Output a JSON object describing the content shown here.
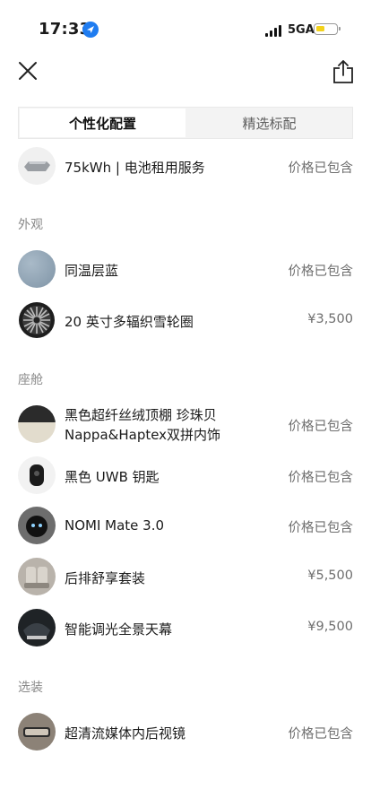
{
  "status_bar": {
    "time": "17:33",
    "network": "5GA"
  },
  "tabs": [
    {
      "label": "个性化配置",
      "active": true
    },
    {
      "label": "精选标配",
      "active": false
    }
  ],
  "battery_item": {
    "label": "75kWh | 电池租用服务",
    "price": "价格已包含"
  },
  "exterior": {
    "title": "外观",
    "items": [
      {
        "label": "同温层蓝",
        "price": "价格已包含"
      },
      {
        "label": "20 英寸多辐织雪轮圈",
        "price": "¥3,500"
      }
    ]
  },
  "cabin": {
    "title": "座舱",
    "items": [
      {
        "label": "黑色超纤丝绒顶棚 珍珠贝 Nappa&Haptex双拼内饰",
        "price": "价格已包含"
      },
      {
        "label": "黑色 UWB 钥匙",
        "price": "价格已包含"
      },
      {
        "label": "NOMI Mate 3.0",
        "price": "价格已包含"
      },
      {
        "label": "后排舒享套装",
        "price": "¥5,500"
      },
      {
        "label": "智能调光全景天幕",
        "price": "¥9,500"
      }
    ]
  },
  "options": {
    "title": "选装",
    "items": [
      {
        "label": "超清流媒体内后视镜",
        "price": "价格已包含"
      }
    ]
  },
  "colors": {
    "accent_location": "#1f7cf0",
    "battery_fill": "#f3d21b",
    "paint_blue": "#8fa2b3"
  }
}
